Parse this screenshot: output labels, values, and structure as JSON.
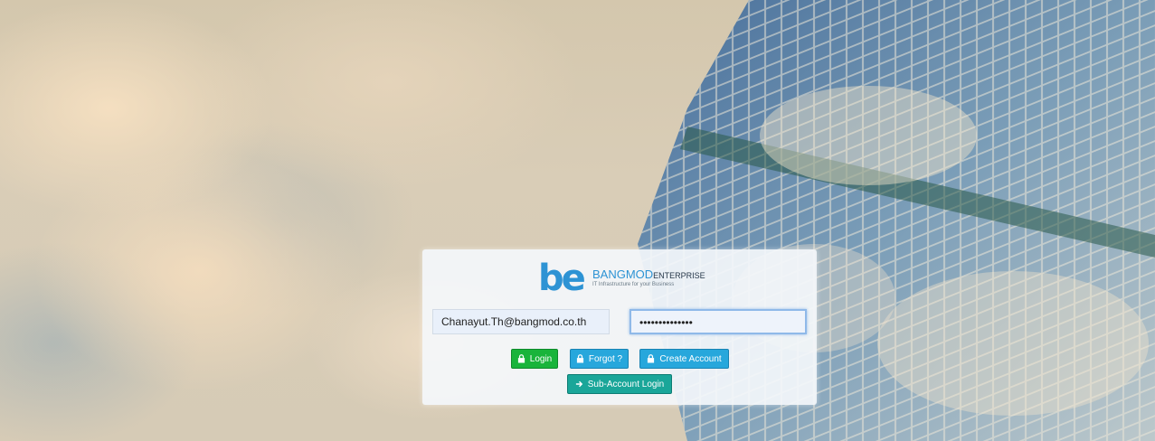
{
  "brand": {
    "logo_mark": "be",
    "name": "BANGMOD",
    "name_suffix": "ENTERPRISE",
    "tagline": "IT Infrastructure for your Business"
  },
  "form": {
    "email_value": "Chanayut.Th@bangmod.co.th",
    "password_mask": "••••••••••••••"
  },
  "buttons": {
    "login": "Login",
    "forgot": "Forgot ?",
    "create_account": "Create Account",
    "sub_account_login": "Sub-Account Login"
  },
  "colors": {
    "brand_blue": "#2d93d4",
    "login_green": "#19b43b",
    "info_blue": "#27a7dc",
    "teal": "#1aa699"
  },
  "icons": {
    "login": "lock-icon",
    "forgot": "lock-icon",
    "create_account": "lock-icon",
    "sub_account_login": "arrow-right-icon"
  }
}
